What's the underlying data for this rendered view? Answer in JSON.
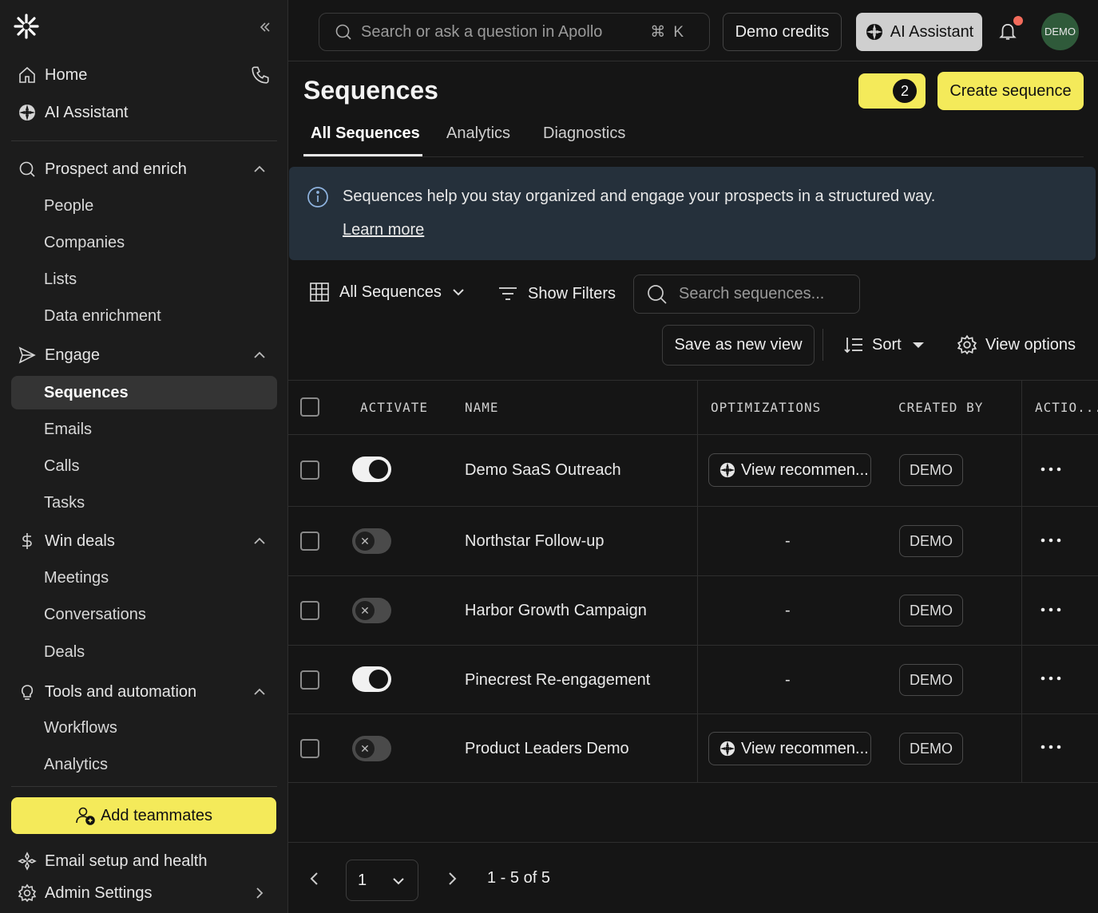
{
  "sidebar": {
    "top_items": [
      {
        "label": "Home",
        "icon": "home-icon"
      },
      {
        "label": "AI Assistant",
        "icon": "ai-assistant-icon"
      }
    ],
    "sections": [
      {
        "label": "Prospect and enrich",
        "icon": "search-icon",
        "items": [
          "People",
          "Companies",
          "Lists",
          "Data enrichment"
        ]
      },
      {
        "label": "Engage",
        "icon": "send-icon",
        "items": [
          "Sequences",
          "Emails",
          "Calls",
          "Tasks"
        ],
        "active": "Sequences"
      },
      {
        "label": "Win deals",
        "icon": "dollar-icon",
        "items": [
          "Meetings",
          "Conversations",
          "Deals"
        ]
      },
      {
        "label": "Tools and automation",
        "icon": "lightbulb-icon",
        "items": [
          "Workflows",
          "Analytics"
        ]
      }
    ],
    "add_teammates": "Add teammates",
    "bottom_items": [
      {
        "label": "Email setup and health",
        "icon": "email-setup-icon"
      },
      {
        "label": "Admin Settings",
        "icon": "gear-icon"
      }
    ]
  },
  "topbar": {
    "search_placeholder": "Search or ask a question in Apollo",
    "shortcut": "⌘K",
    "demo_credits": "Demo credits",
    "ai_assistant": "AI Assistant",
    "avatar": "DEMO"
  },
  "page": {
    "title": "Sequences",
    "badge_count": "2",
    "create_button": "Create sequence",
    "tabs": [
      "All Sequences",
      "Analytics",
      "Diagnostics"
    ],
    "active_tab": "All Sequences"
  },
  "banner": {
    "message": "Sequences help you stay organized and engage your prospects in a structured way.",
    "link": "Learn more"
  },
  "toolbar": {
    "view_select": "All Sequences",
    "show_filters": "Show Filters",
    "search_placeholder": "Search sequences...",
    "save_view": "Save as new view",
    "sort": "Sort",
    "view_options": "View options"
  },
  "table": {
    "columns": [
      "ACTIVATE",
      "NAME",
      "OPTIMIZATIONS",
      "CREATED BY",
      "ACTIO..."
    ],
    "rows": [
      {
        "active": true,
        "name": "Demo SaaS Outreach",
        "optimization": "View recommen...",
        "created_by": "DEMO"
      },
      {
        "active": false,
        "name": "Northstar Follow-up",
        "optimization": "-",
        "created_by": "DEMO"
      },
      {
        "active": false,
        "name": "Harbor Growth Campaign",
        "optimization": "-",
        "created_by": "DEMO"
      },
      {
        "active": true,
        "name": "Pinecrest Re-engagement",
        "optimization": "-",
        "created_by": "DEMO"
      },
      {
        "active": false,
        "name": "Product Leaders Demo",
        "optimization": "View recommen...",
        "created_by": "DEMO"
      }
    ]
  },
  "pagination": {
    "page": "1",
    "range": "1 - 5 of 5"
  },
  "colors": {
    "accent": "#f4ea5a",
    "background": "#151515",
    "sidebar": "#1c1c1c",
    "banner": "#25303b",
    "notification_dot": "#f26b5b"
  }
}
